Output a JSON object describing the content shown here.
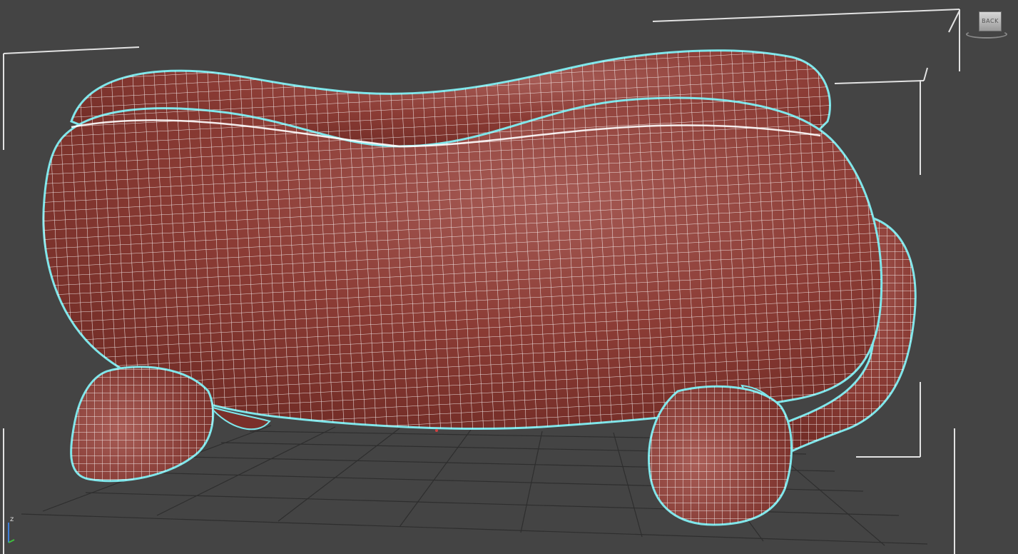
{
  "viewport": {
    "background": "#444444",
    "grid_color": "#2e2e2e",
    "bbox_color": "#e6e6e6",
    "mesh_color": "#8b3b34",
    "wire_color": "#ffffff",
    "selection_outline": "#7fe6ea"
  },
  "viewcube": {
    "face_label": "BACK",
    "icon": "viewcube-icon"
  },
  "axis_tripod": {
    "z_label": "z"
  },
  "object": {
    "type": "couch",
    "selected": true
  }
}
